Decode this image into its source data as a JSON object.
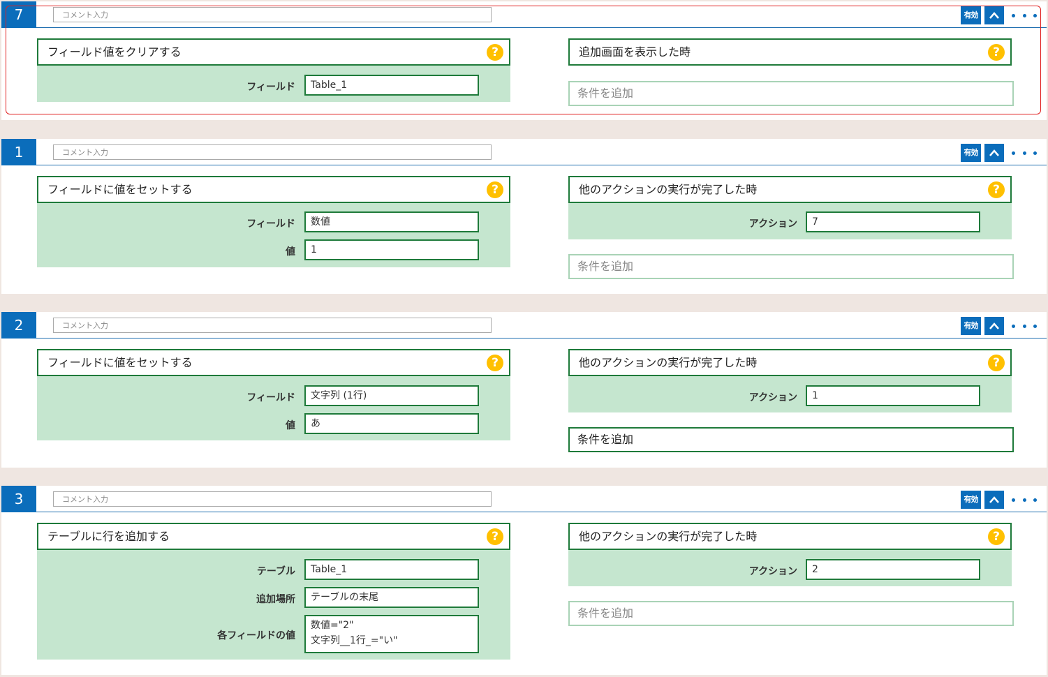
{
  "blocks": [
    {
      "number": "7",
      "comment_placeholder": "コメント入力",
      "enabled_label": "有効",
      "action": {
        "title": "フィールド値をクリアする",
        "help": "?",
        "rows": [
          {
            "label": "フィールド",
            "value": "Table_1"
          }
        ]
      },
      "trigger": {
        "title": "追加画面を表示した時",
        "help": "?",
        "rows": []
      },
      "add_condition": "条件を追加"
    },
    {
      "number": "1",
      "comment_placeholder": "コメント入力",
      "enabled_label": "有効",
      "action": {
        "title": "フィールドに値をセットする",
        "help": "?",
        "rows": [
          {
            "label": "フィールド",
            "value": "数値"
          },
          {
            "label": "値",
            "value": "1"
          }
        ]
      },
      "trigger": {
        "title": "他のアクションの実行が完了した時",
        "help": "?",
        "rows": [
          {
            "label": "アクション",
            "value": "7"
          }
        ]
      },
      "add_condition": "条件を追加"
    },
    {
      "number": "2",
      "comment_placeholder": "コメント入力",
      "enabled_label": "有効",
      "action": {
        "title": "フィールドに値をセットする",
        "help": "?",
        "rows": [
          {
            "label": "フィールド",
            "value": "文字列 (1行)"
          },
          {
            "label": "値",
            "value": "あ"
          }
        ]
      },
      "trigger": {
        "title": "他のアクションの実行が完了した時",
        "help": "?",
        "rows": [
          {
            "label": "アクション",
            "value": "1"
          }
        ]
      },
      "add_condition": "条件を追加"
    },
    {
      "number": "3",
      "comment_placeholder": "コメント入力",
      "enabled_label": "有効",
      "action": {
        "title": "テーブルに行を追加する",
        "help": "?",
        "rows": [
          {
            "label": "テーブル",
            "value": "Table_1"
          },
          {
            "label": "追加場所",
            "value": "テーブルの末尾"
          },
          {
            "label": "各フィールドの値",
            "value_line1": "数値=\"2\"",
            "value_line2": "文字列__1行_=\"い\""
          }
        ]
      },
      "trigger": {
        "title": "他のアクションの実行が完了した時",
        "help": "?",
        "rows": [
          {
            "label": "アクション",
            "value": "2"
          }
        ]
      },
      "add_condition": "条件を追加"
    }
  ],
  "colors": {
    "accent_blue": "#0b6dbb",
    "panel_green": "#c5e6cf",
    "border_green": "#1e7a3a",
    "help_yellow": "#ffc000",
    "selection_red": "#e02020"
  }
}
